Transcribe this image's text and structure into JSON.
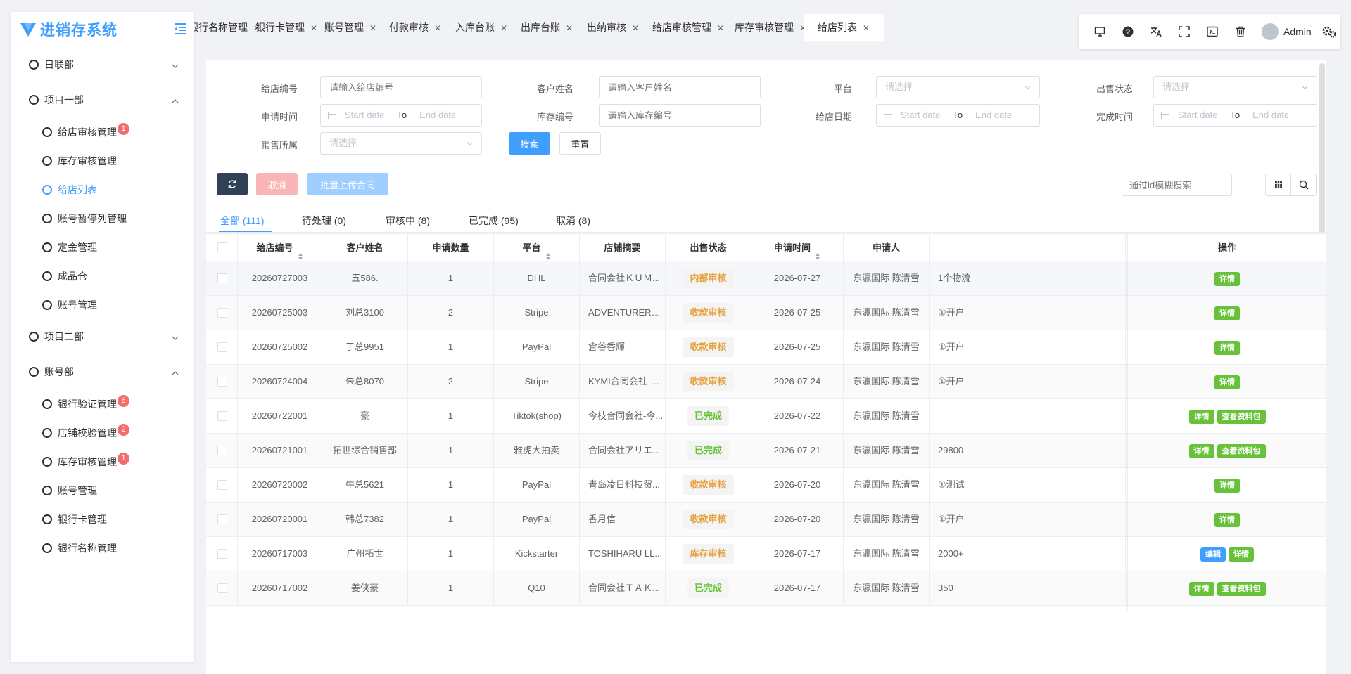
{
  "app": {
    "title": "进销存系统"
  },
  "sidebar": {
    "groups": [
      {
        "label": "日联部",
        "expanded": false
      },
      {
        "label": "项目一部",
        "expanded": true,
        "items": [
          {
            "label": "给店审核管理",
            "badge": "1"
          },
          {
            "label": "库存审核管理",
            "badge": ""
          },
          {
            "label": "给店列表",
            "badge": "",
            "active": true
          },
          {
            "label": "账号暂停列管理",
            "badge": ""
          },
          {
            "label": "定金管理",
            "badge": ""
          },
          {
            "label": "成品仓",
            "badge": ""
          },
          {
            "label": "账号管理",
            "badge": ""
          }
        ]
      },
      {
        "label": "项目二部",
        "expanded": false
      },
      {
        "label": "账号部",
        "expanded": true,
        "items": [
          {
            "label": "银行验证管理",
            "badge": "6"
          },
          {
            "label": "店铺校验管理",
            "badge": "2"
          },
          {
            "label": "库存审核管理",
            "badge": "1"
          },
          {
            "label": "账号管理",
            "badge": ""
          },
          {
            "label": "银行卡管理",
            "badge": ""
          },
          {
            "label": "银行名称管理",
            "badge": ""
          }
        ]
      }
    ]
  },
  "tabs": [
    {
      "label": "银行名称管理"
    },
    {
      "label": "银行卡管理"
    },
    {
      "label": "账号管理"
    },
    {
      "label": "付款审核"
    },
    {
      "label": "入库台账"
    },
    {
      "label": "出库台账"
    },
    {
      "label": "出纳审核"
    },
    {
      "label": "给店审核管理"
    },
    {
      "label": "库存审核管理"
    },
    {
      "label": "给店列表",
      "active": true
    }
  ],
  "toolbar": {
    "user": "Admin"
  },
  "filters": {
    "shop_no": {
      "label": "给店编号",
      "placeholder": "请输入给店编号"
    },
    "customer": {
      "label": "客户姓名",
      "placeholder": "请输入客户姓名"
    },
    "platform": {
      "label": "平台",
      "placeholder": "请选择"
    },
    "sale_status": {
      "label": "出售状态",
      "placeholder": "请选择"
    },
    "apply_time": {
      "label": "申请时间",
      "start": "Start date",
      "to": "To",
      "end": "End date"
    },
    "stock_no": {
      "label": "库存编号",
      "placeholder": "请输入库存编号"
    },
    "shop_date": {
      "label": "给店日期",
      "start": "Start date",
      "to": "To",
      "end": "End date"
    },
    "finish_time": {
      "label": "完成时间",
      "start": "Start date",
      "to": "To",
      "end": "End date"
    },
    "belong": {
      "label": "销售所属",
      "placeholder": "请选择"
    },
    "search_btn": "搜索",
    "reset_btn": "重置"
  },
  "actions": {
    "cancel": "取消",
    "batch_upload": "批量上传合同",
    "id_search_placeholder": "通过id模糊搜索"
  },
  "status_tabs": [
    {
      "label": "全部 (111)",
      "active": true
    },
    {
      "label": "待处理 (0)"
    },
    {
      "label": "审核中 (8)"
    },
    {
      "label": "已完成 (95)"
    },
    {
      "label": "取消 (8)"
    }
  ],
  "table": {
    "headers": [
      "给店编号",
      "客户姓名",
      "申请数量",
      "平台",
      "店铺摘要",
      "出售状态",
      "申请时间",
      "申请人",
      "",
      "操作"
    ],
    "rows": [
      {
        "no": "20260727003",
        "customer": "五586.",
        "qty": "1",
        "platform": "DHL",
        "shop": "合同会社ＫＵＭ...",
        "status": "内部审核",
        "status_color": "orange",
        "date": "2026-07-27",
        "applicant": "东瀛国际 陈清雪",
        "note": "1个物流",
        "ops": [
          "详情"
        ]
      },
      {
        "no": "20260725003",
        "customer": "刘总3100",
        "qty": "2",
        "platform": "Stripe",
        "shop": "ADVENTURERA...",
        "status": "收款审核",
        "status_color": "orange",
        "date": "2026-07-25",
        "applicant": "东瀛国际 陈清雪",
        "note": "①开户",
        "ops": [
          "详情"
        ]
      },
      {
        "no": "20260725002",
        "customer": "于总9951",
        "qty": "1",
        "platform": "PayPal",
        "shop": "倉谷香輝",
        "status": "收款审核",
        "status_color": "orange",
        "date": "2026-07-25",
        "applicant": "东瀛国际 陈清雪",
        "note": "①开户",
        "ops": [
          "详情"
        ]
      },
      {
        "no": "20260724004",
        "customer": "朱总8070",
        "qty": "2",
        "platform": "Stripe",
        "shop": "KYMI合同会社-森...",
        "status": "收款审核",
        "status_color": "orange",
        "date": "2026-07-24",
        "applicant": "东瀛国际 陈清雪",
        "note": "①开户",
        "ops": [
          "详情"
        ]
      },
      {
        "no": "20260722001",
        "customer": "豪",
        "qty": "1",
        "platform": "Tiktok(shop)",
        "shop": "今枝合同会社-今...",
        "status": "已完成",
        "status_color": "green",
        "date": "2026-07-22",
        "applicant": "东瀛国际 陈清雪",
        "note": "",
        "ops": [
          "详情",
          "查看资料包"
        ]
      },
      {
        "no": "20260721001",
        "customer": "拓世综合销售部",
        "qty": "1",
        "platform": "雅虎大拍卖",
        "shop": "合同会社アリエ...",
        "status": "已完成",
        "status_color": "green",
        "date": "2026-07-21",
        "applicant": "东瀛国际 陈清雪",
        "note": "29800",
        "ops": [
          "详情",
          "查看资料包"
        ]
      },
      {
        "no": "20260720002",
        "customer": "牛总5621",
        "qty": "1",
        "platform": "PayPal",
        "shop": "青岛凌日科技贸...",
        "status": "收款审核",
        "status_color": "orange",
        "date": "2026-07-20",
        "applicant": "东瀛国际 陈清雪",
        "note": "①测试",
        "ops": [
          "详情"
        ]
      },
      {
        "no": "20260720001",
        "customer": "韩总7382",
        "qty": "1",
        "platform": "PayPal",
        "shop": "香月信",
        "status": "收款审核",
        "status_color": "orange",
        "date": "2026-07-20",
        "applicant": "东瀛国际 陈清雪",
        "note": "①开户",
        "ops": [
          "详情"
        ]
      },
      {
        "no": "20260717003",
        "customer": "广州拓世",
        "qty": "1",
        "platform": "Kickstarter",
        "shop": "TOSHIHARU LL...",
        "status": "库存审核",
        "status_color": "orange",
        "date": "2026-07-17",
        "applicant": "东瀛国际 陈清雪",
        "note": "2000+",
        "ops": [
          "编辑",
          "详情"
        ]
      },
      {
        "no": "20260717002",
        "customer": "姜侠豪",
        "qty": "1",
        "platform": "Q10",
        "shop": "合同会社ＴＡＫ...",
        "status": "已完成",
        "status_color": "green",
        "date": "2026-07-17",
        "applicant": "东瀛国际 陈清雪",
        "note": "350",
        "ops": [
          "详情",
          "查看资料包"
        ]
      }
    ]
  },
  "colors": {
    "primary": "#409eff",
    "success": "#67c23a",
    "warning": "#e6a23c",
    "danger": "#f56c6c",
    "dark": "#304156"
  }
}
